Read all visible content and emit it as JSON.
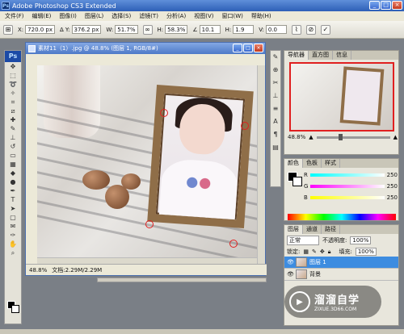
{
  "app": {
    "title": "Adobe Photoshop CS3 Extended",
    "logo": "Ps"
  },
  "menu": [
    "文件(F)",
    "编辑(E)",
    "图像(I)",
    "图层(L)",
    "选择(S)",
    "滤镜(T)",
    "分析(A)",
    "视图(V)",
    "窗口(W)",
    "帮助(H)"
  ],
  "options": {
    "x_label": "X:",
    "x_value": "720.0 px",
    "y_label": "Y:",
    "y_value": "376.2 px",
    "w_label": "W:",
    "w_value": "51.7%",
    "h_label": "H:",
    "h_value": "58.3%",
    "angle_value": "10.1",
    "hskew_label": "H:",
    "hskew_value": "1.9",
    "vskew_label": "V:",
    "vskew_value": "0.0"
  },
  "document": {
    "title": "素材11（1）.jpg @ 48.8% (图层 1, RGB/8#)",
    "zoom": "48.8%",
    "doc_info": "文档:2.29M/2.29M"
  },
  "navigator": {
    "tabs": [
      "导航器",
      "直方图",
      "信息"
    ],
    "zoom": "48.8%"
  },
  "color": {
    "tabs": [
      "颜色",
      "色板",
      "样式"
    ],
    "r_label": "R",
    "r_value": "250",
    "g_label": "G",
    "g_value": "250",
    "b_label": "B",
    "b_value": "250"
  },
  "layers": {
    "tabs": [
      "图层",
      "通道",
      "路径"
    ],
    "blend_mode": "正常",
    "opacity_label": "不透明度:",
    "opacity_value": "100%",
    "lock_label": "锁定:",
    "fill_label": "填充:",
    "fill_value": "100%",
    "items": [
      "图层 1",
      "背景"
    ]
  },
  "watermark": {
    "title": "溜溜自学",
    "url": "ZIXUE.3D66.COM"
  }
}
